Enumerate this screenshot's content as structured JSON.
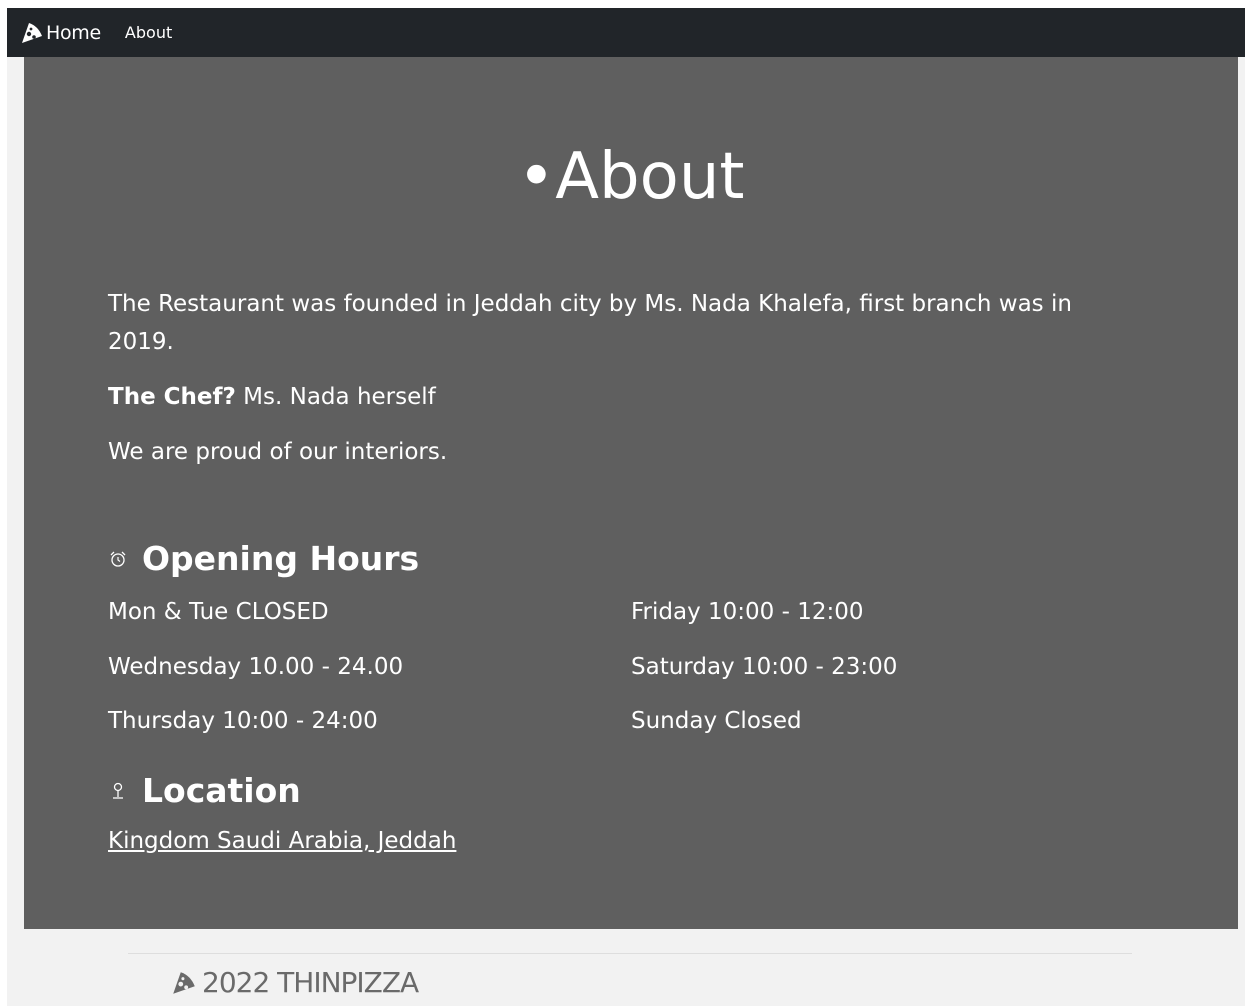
{
  "navbar": {
    "brand_icon": "pizza-slice-icon",
    "home_label": "Home",
    "about_label": "About",
    "background": "#212529"
  },
  "main": {
    "title": "•About",
    "intro": "The Restaurant was founded in Jeddah city by Ms. Nada Khalefa, first branch was in 2019.",
    "chef_label": "The Chef?",
    "chef_value": " Ms. Nada herself",
    "interiors": "We are proud of our interiors.",
    "background": "#5f5f5f"
  },
  "opening_hours": {
    "icon": "alarm-clock-icon",
    "heading": "Opening Hours",
    "left": [
      "Mon & Tue CLOSED",
      "Wednesday 10.00 - 24.00",
      "Thursday 10:00 - 24:00"
    ],
    "right": [
      "Friday 10:00 - 12:00",
      "Saturday 10:00 - 23:00",
      "Sunday Closed"
    ]
  },
  "location": {
    "icon": "map-pin-icon",
    "heading": "Location",
    "link_text": "Kingdom Saudi Arabia, Jeddah"
  },
  "footer": {
    "icon": "pizza-slice-icon",
    "text": "2022 THINPIZZA"
  }
}
